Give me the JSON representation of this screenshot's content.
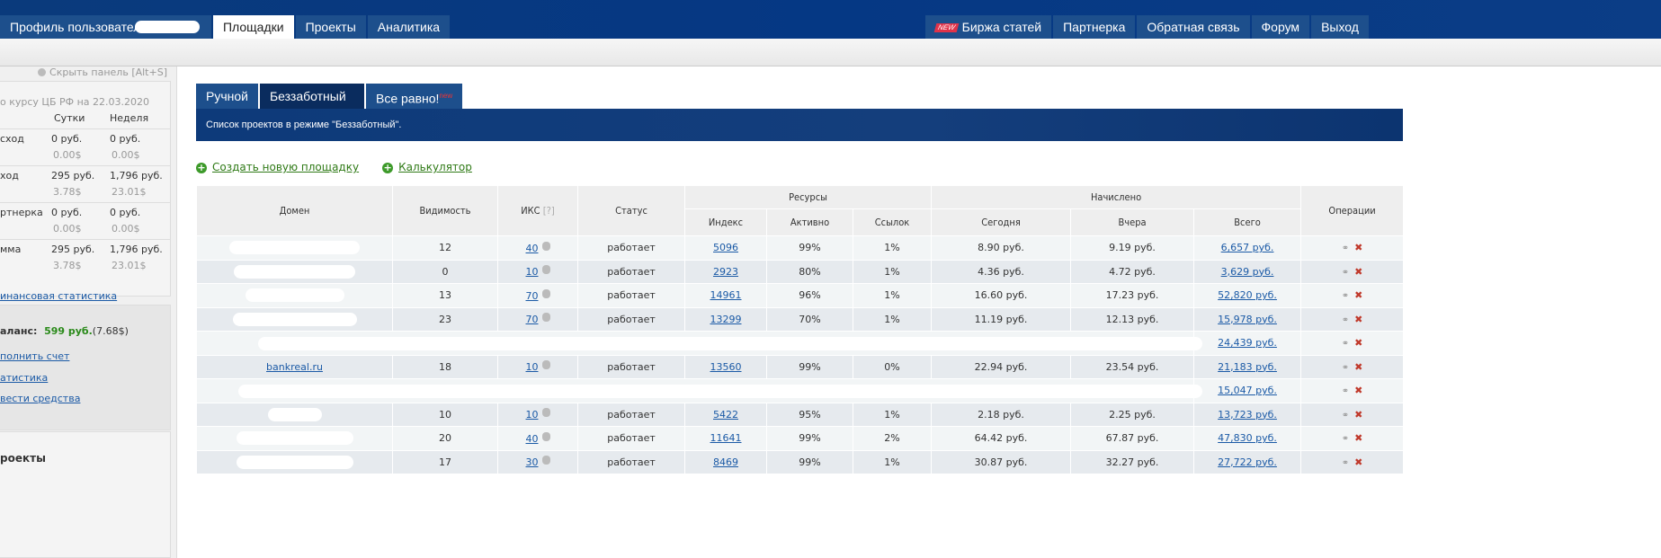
{
  "topnav_left": [
    "Профиль пользователя",
    "Площадки",
    "Проекты",
    "Аналитика"
  ],
  "topnav_right": {
    "new_badge": "NEW",
    "items": [
      "Биржа статей",
      "Партнерка",
      "Обратная связь",
      "Форум",
      "Выход"
    ]
  },
  "sidebar": {
    "hide_panel": "Скрыть панель [Alt+S]",
    "rate_note": "о курсу ЦБ РФ на 22.03.2020",
    "col_day": "Сутки",
    "col_week": "Неделя",
    "rows": [
      {
        "label": "сход",
        "day": "0 руб.",
        "day_usd": "0.00$",
        "week": "0 руб.",
        "week_usd": "0.00$"
      },
      {
        "label": "ход",
        "day": "295 руб.",
        "day_usd": "3.78$",
        "week": "1,796 руб.",
        "week_usd": "23.01$"
      },
      {
        "label": "ртнерка",
        "day": "0 руб.",
        "day_usd": "0.00$",
        "week": "0 руб.",
        "week_usd": "0.00$"
      },
      {
        "label": "мма",
        "day": "295 руб.",
        "day_usd": "3.78$",
        "week": "1,796 руб.",
        "week_usd": "23.01$"
      }
    ],
    "fin_stats": "инансовая статистика",
    "balance_label": "аланс:",
    "balance": "599 руб.",
    "balance_usd": "(7.68$)",
    "links": [
      "полнить счет",
      "атистика",
      "вести средства"
    ],
    "projects": "роекты"
  },
  "tabs": {
    "manual": "Ручной",
    "carefree": "Беззаботный",
    "whatever": "Все равно!",
    "new": "new"
  },
  "banner": "Список проектов в режиме \"Беззаботный\".",
  "actions": {
    "create": "Создать новую площадку",
    "calc": "Калькулятор"
  },
  "table": {
    "h": {
      "domain": "Домен",
      "visibility": "Видимость",
      "iks": "ИКС",
      "iks_help": "[?]",
      "status": "Статус",
      "resources": "Ресурсы",
      "index": "Индекс",
      "active": "Активно",
      "links": "Ссылок",
      "accrued": "Начислено",
      "today": "Сегодня",
      "yesterday": "Вчера",
      "total": "Всего",
      "ops": "Операции"
    },
    "rows": [
      {
        "domain": null,
        "vis": "12",
        "iks": "40",
        "status": "работает",
        "index": "5096",
        "active": "99%",
        "links": "1%",
        "today": "8.90 руб.",
        "yest": "9.19 руб.",
        "total": "6,657 руб."
      },
      {
        "domain": null,
        "vis": "0",
        "iks": "10",
        "status": "работает",
        "index": "2923",
        "active": "80%",
        "links": "1%",
        "today": "4.36 руб.",
        "yest": "4.72 руб.",
        "total": "3,629 руб."
      },
      {
        "domain": null,
        "vis": "13",
        "iks": "70",
        "status": "работает",
        "index": "14961",
        "active": "96%",
        "links": "1%",
        "today": "16.60 руб.",
        "yest": "17.23 руб.",
        "total": "52,820 руб."
      },
      {
        "domain": null,
        "vis": "23",
        "iks": "70",
        "status": "работает",
        "index": "13299",
        "active": "70%",
        "links": "1%",
        "today": "11.19 руб.",
        "yest": "12.13 руб.",
        "total": "15,978 руб."
      },
      {
        "redacted": true,
        "total": "24,439 руб."
      },
      {
        "domain": "bankreal.ru",
        "vis": "18",
        "iks": "10",
        "status": "работает",
        "index": "13560",
        "active": "99%",
        "links": "0%",
        "today": "22.94 руб.",
        "yest": "23.54 руб.",
        "total": "21,183 руб."
      },
      {
        "redacted": true,
        "total": "15,047 руб."
      },
      {
        "domain": null,
        "vis": "10",
        "iks": "10",
        "status": "работает",
        "index": "5422",
        "active": "95%",
        "links": "1%",
        "today": "2.18 руб.",
        "yest": "2.25 руб.",
        "total": "13,723 руб."
      },
      {
        "domain": null,
        "vis": "20",
        "iks": "40",
        "status": "работает",
        "index": "11641",
        "active": "99%",
        "links": "2%",
        "today": "64.42 руб.",
        "yest": "67.87 руб.",
        "total": "47,830 руб."
      },
      {
        "domain": null,
        "vis": "17",
        "iks": "30",
        "status": "работает",
        "index": "8469",
        "active": "99%",
        "links": "1%",
        "today": "30.87 руб.",
        "yest": "32.27 руб.",
        "total": "27,722 руб."
      }
    ]
  }
}
